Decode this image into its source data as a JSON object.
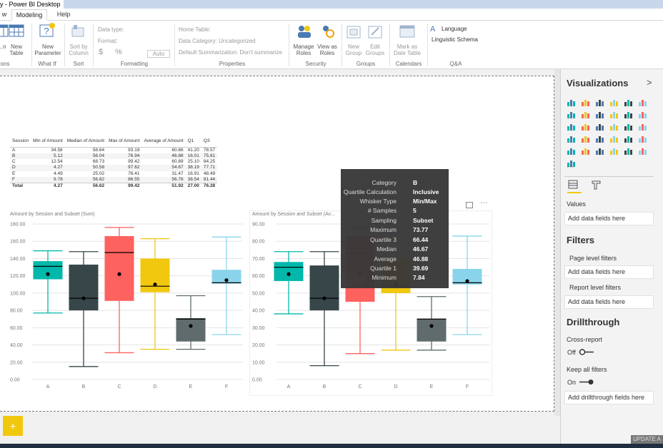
{
  "window": {
    "title": "y - Power BI Desktop"
  },
  "tabs": [
    {
      "label": "w"
    },
    {
      "label": "Modeling"
    },
    {
      "label": "Help"
    }
  ],
  "ribbon": {
    "buttons": {
      "new_column": "...n",
      "new_table": "New\nTable",
      "new_parameter": "New\nParameter",
      "sort_by_column": "Sort by\nColumn",
      "manage_roles": "Manage\nRoles",
      "view_as_roles": "View as\nRoles",
      "new_group": "New\nGroup",
      "edit_groups": "Edit\nGroups",
      "mark_as_date_table": "Mark as\nDate Table",
      "language": "Language",
      "linguistic_schema": "Linguistic Schema"
    },
    "formatting": {
      "data_type": "Data type:",
      "format": "Format:",
      "currency": "$",
      "percent": "%",
      "auto": "Auto"
    },
    "properties": {
      "home_table": "Home Table:",
      "data_category": "Data Category: Uncategorized",
      "default_summarization": "Default Summarization: Don't summarize"
    },
    "groups": [
      "ons",
      "What If",
      "Sort",
      "Formatting",
      "Properties",
      "Security",
      "Groups",
      "Calendars",
      "Q&A"
    ]
  },
  "matrix": {
    "columns": [
      "Session",
      "Min of Amount",
      "Median of Amount",
      "Max of Amount",
      "Average of Amount",
      "Q1",
      "Q3"
    ],
    "rows": [
      [
        "A",
        "34.58",
        "58.64",
        "93.19",
        "60.86",
        "41.20",
        "78.57"
      ],
      [
        "B",
        "5.12",
        "56.04",
        "76.94",
        "46.88",
        "16.01",
        "75.81"
      ],
      [
        "C",
        "12.54",
        "68.73",
        "99.42",
        "60.89",
        "25.10",
        "84.25"
      ],
      [
        "D",
        "4.27",
        "50.58",
        "97.62",
        "54.67",
        "38.19",
        "77.71"
      ],
      [
        "E",
        "4.49",
        "25.02",
        "76.41",
        "31.47",
        "16.91",
        "48.49"
      ],
      [
        "F",
        "9.78",
        "56.82",
        "86.55",
        "56.76",
        "38.54",
        "81.44"
      ]
    ],
    "total": [
      "Total",
      "4.27",
      "56.62",
      "99.42",
      "51.92",
      "27.00",
      "76.28"
    ]
  },
  "chart_data": [
    {
      "type": "boxplot",
      "title": "Amount by Session and Subset (Sum)",
      "categories": [
        "A",
        "B",
        "C",
        "D",
        "E",
        "F"
      ],
      "colors": [
        "#01b8aa",
        "#374649",
        "#fd625e",
        "#f2c80f",
        "#5f6b6d",
        "#8ad4eb"
      ],
      "ylim": [
        0,
        180
      ],
      "yticks": [
        "0.00",
        "20.00",
        "40.00",
        "60.00",
        "80.00",
        "100.00",
        "120.00",
        "140.00",
        "160.00",
        "180.00"
      ],
      "boxes": [
        {
          "min": 77,
          "q1": 116,
          "median": 131,
          "q3": 137,
          "max": 149,
          "mean": 122
        },
        {
          "min": 15,
          "q1": 80,
          "median": 94,
          "q3": 133,
          "max": 148,
          "mean": 94
        },
        {
          "min": 31,
          "q1": 91,
          "median": 147,
          "q3": 166,
          "max": 176,
          "mean": 122
        },
        {
          "min": 35,
          "q1": 101,
          "median": 108,
          "q3": 140,
          "max": 163,
          "mean": 110
        },
        {
          "min": 35,
          "q1": 44,
          "median": 70,
          "q3": 71,
          "max": 97,
          "mean": 62
        },
        {
          "min": 52,
          "q1": 111,
          "median": 112,
          "q3": 127,
          "max": 165,
          "mean": 115
        }
      ]
    },
    {
      "type": "boxplot",
      "title": "Amount by Session and Subset (Av...",
      "categories": [
        "A",
        "B",
        "C",
        "D",
        "E",
        "F"
      ],
      "colors": [
        "#01b8aa",
        "#374649",
        "#fd625e",
        "#f2c80f",
        "#5f6b6d",
        "#8ad4eb"
      ],
      "ylim": [
        0,
        90
      ],
      "yticks": [
        "0.00",
        "10.00",
        "20.00",
        "30.00",
        "40.00",
        "50.00",
        "60.00",
        "70.00",
        "80.00",
        "90.00"
      ],
      "boxes": [
        {
          "min": 38,
          "q1": 57,
          "median": 65,
          "q3": 68,
          "max": 74,
          "mean": 61
        },
        {
          "min": 8,
          "q1": 40,
          "median": 47,
          "q3": 66,
          "max": 74,
          "mean": 47
        },
        {
          "min": 15,
          "q1": 45,
          "median": 73,
          "q3": 83,
          "max": 88,
          "mean": 61
        },
        {
          "min": 17,
          "q1": 50,
          "median": 54,
          "q3": 70,
          "max": 81,
          "mean": 55
        },
        {
          "min": 17,
          "q1": 22,
          "median": 35,
          "q3": 35,
          "max": 48,
          "mean": 31
        },
        {
          "min": 26,
          "q1": 55,
          "median": 56,
          "q3": 64,
          "max": 83,
          "mean": 57
        }
      ]
    }
  ],
  "tooltip": {
    "rows": [
      {
        "label": "Category",
        "value": "B"
      },
      {
        "label": "Quartile Calculation",
        "value": "Inclusive"
      },
      {
        "label": "Whisker Type",
        "value": "Min/Max"
      },
      {
        "label": "# Samples",
        "value": "5"
      },
      {
        "label": "Sampling",
        "value": "Subset"
      },
      {
        "label": "Maximum",
        "value": "73.77"
      },
      {
        "label": "Quartile 3",
        "value": "66.44"
      },
      {
        "label": "Median",
        "value": "46.67"
      },
      {
        "label": "Average",
        "value": "46.88"
      },
      {
        "label": "Quartile 1",
        "value": "39.69"
      },
      {
        "label": "Minimum",
        "value": "7.84"
      }
    ]
  },
  "panel": {
    "title": "Visualizations",
    "expand": ">",
    "values_label": "Values",
    "add_fields": "Add data fields here",
    "filters_title": "Filters",
    "page_level": "Page level filters",
    "report_level": "Report level filters",
    "drillthrough_title": "Drillthrough",
    "cross_report": "Cross-report",
    "cross_report_state": "Off",
    "keep_filters": "Keep all filters",
    "keep_filters_state": "On",
    "add_drillthrough": "Add drillthrough fields here",
    "update": "UPDATE A"
  },
  "pages": {
    "add": "+"
  }
}
